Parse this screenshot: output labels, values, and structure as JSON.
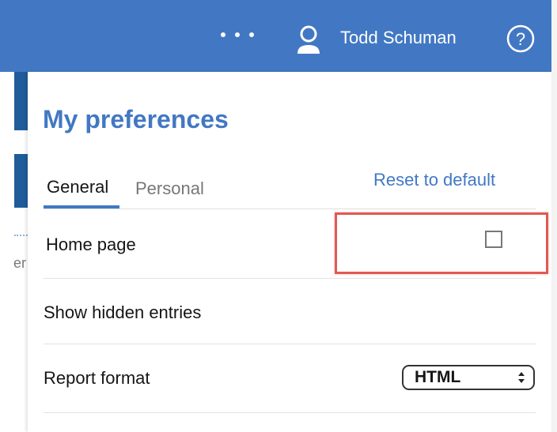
{
  "header": {
    "user_name": "Todd Schuman",
    "icons": [
      "more-icon",
      "user-icon",
      "help-icon"
    ]
  },
  "background": {
    "partial_text": "er"
  },
  "preferences": {
    "title": "My preferences",
    "tabs": [
      {
        "label": "General",
        "active": true
      },
      {
        "label": "Personal",
        "active": false
      }
    ],
    "home_page": {
      "label": "Home page",
      "reset_label": "Reset to default"
    },
    "show_hidden": {
      "label": "Show hidden entries",
      "checked": false
    },
    "report_format": {
      "label": "Report format",
      "value": "HTML"
    }
  },
  "colors": {
    "brand_blue": "#4278c3",
    "highlight_red": "#e05a52"
  }
}
